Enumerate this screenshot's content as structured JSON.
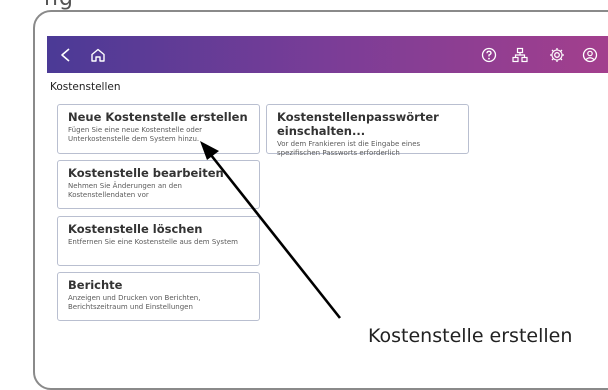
{
  "header": {
    "partial_text": "ng",
    "icons": [
      "back-icon",
      "home-icon",
      "help-icon",
      "network-icon",
      "settings-icon",
      "account-icon"
    ]
  },
  "screen": {
    "title": "Kostenstellen",
    "cards": [
      {
        "title": "Neue Kostenstelle erstellen",
        "desc": "Fügen Sie eine neue Kostenstelle oder Unterkostenstelle dem System hinzu."
      },
      {
        "title": "Kostenstellenpasswörter einschalten...",
        "desc": "Vor dem Frankieren ist die Eingabe eines spezifischen Passworts erforderlich"
      },
      {
        "title": "Kostenstelle bearbeiten",
        "desc": "Nehmen Sie Änderungen an den Kostenstellendaten vor"
      },
      {
        "title": "Kostenstelle löschen",
        "desc": "Entfernen Sie eine Kostenstelle aus dem System"
      },
      {
        "title": "Berichte",
        "desc": "Anzeigen und Drucken von Berichten, Berichtszeitraum und Einstellungen"
      }
    ]
  },
  "annotation": {
    "label": "Kostenstelle erstellen",
    "color": "#000000"
  },
  "colors": {
    "appbar_start": "#4b3a96",
    "appbar_end": "#a33f8d",
    "card_border": "#b9bfd0"
  }
}
